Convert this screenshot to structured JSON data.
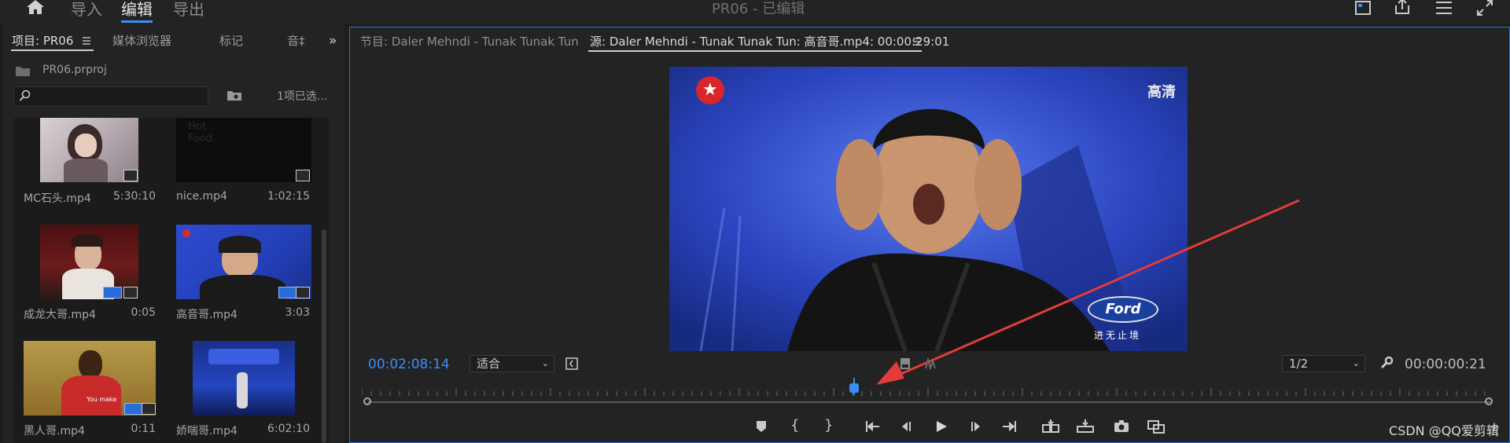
{
  "app": {
    "title": "PR06 - 已编辑",
    "nav": {
      "import": "导入",
      "edit": "编辑",
      "export": "导出"
    }
  },
  "project_panel": {
    "tabs": [
      "项目: PR06",
      "媒体浏览器",
      "标记",
      "音‡"
    ],
    "file": "PR06.prproj",
    "search_placeholder": "",
    "selection_status": "1项已选...",
    "clips": [
      {
        "name": "MC石头.mp4",
        "duration": "5:30:10"
      },
      {
        "name": "nice.mp4",
        "duration": "1:02:15"
      },
      {
        "name": "成龙大哥.mp4",
        "duration": "0:05"
      },
      {
        "name": "高音哥.mp4",
        "duration": "3:03"
      },
      {
        "name": "黑人哥.mp4",
        "duration": "0:11"
      },
      {
        "name": "娇喘哥.mp4",
        "duration": "6:02:10"
      }
    ],
    "thumb_texts": {
      "nice_overlay": "Hot\nFood",
      "black_guy_caption": "You make"
    }
  },
  "monitor": {
    "tab_program": "节目: Daler Mehndi - Tunak Tunak Tun",
    "tab_source": "源: Daler Mehndi - Tunak Tunak Tun: 高音哥.mp4: 00:00:29:01",
    "video_corner_label": "高清",
    "sponsor_logo": "Ford",
    "sponsor_slogan": "进无止境",
    "current_time": "00:02:08:14",
    "fit_option": "适合",
    "resolution": "1/2",
    "duration": "00:00:00:21"
  },
  "watermark": "CSDN @QQ爱剪辑",
  "colors": {
    "accent": "#3b8df5",
    "arrow": "#e23b3b",
    "panel_bg": "#232323"
  }
}
